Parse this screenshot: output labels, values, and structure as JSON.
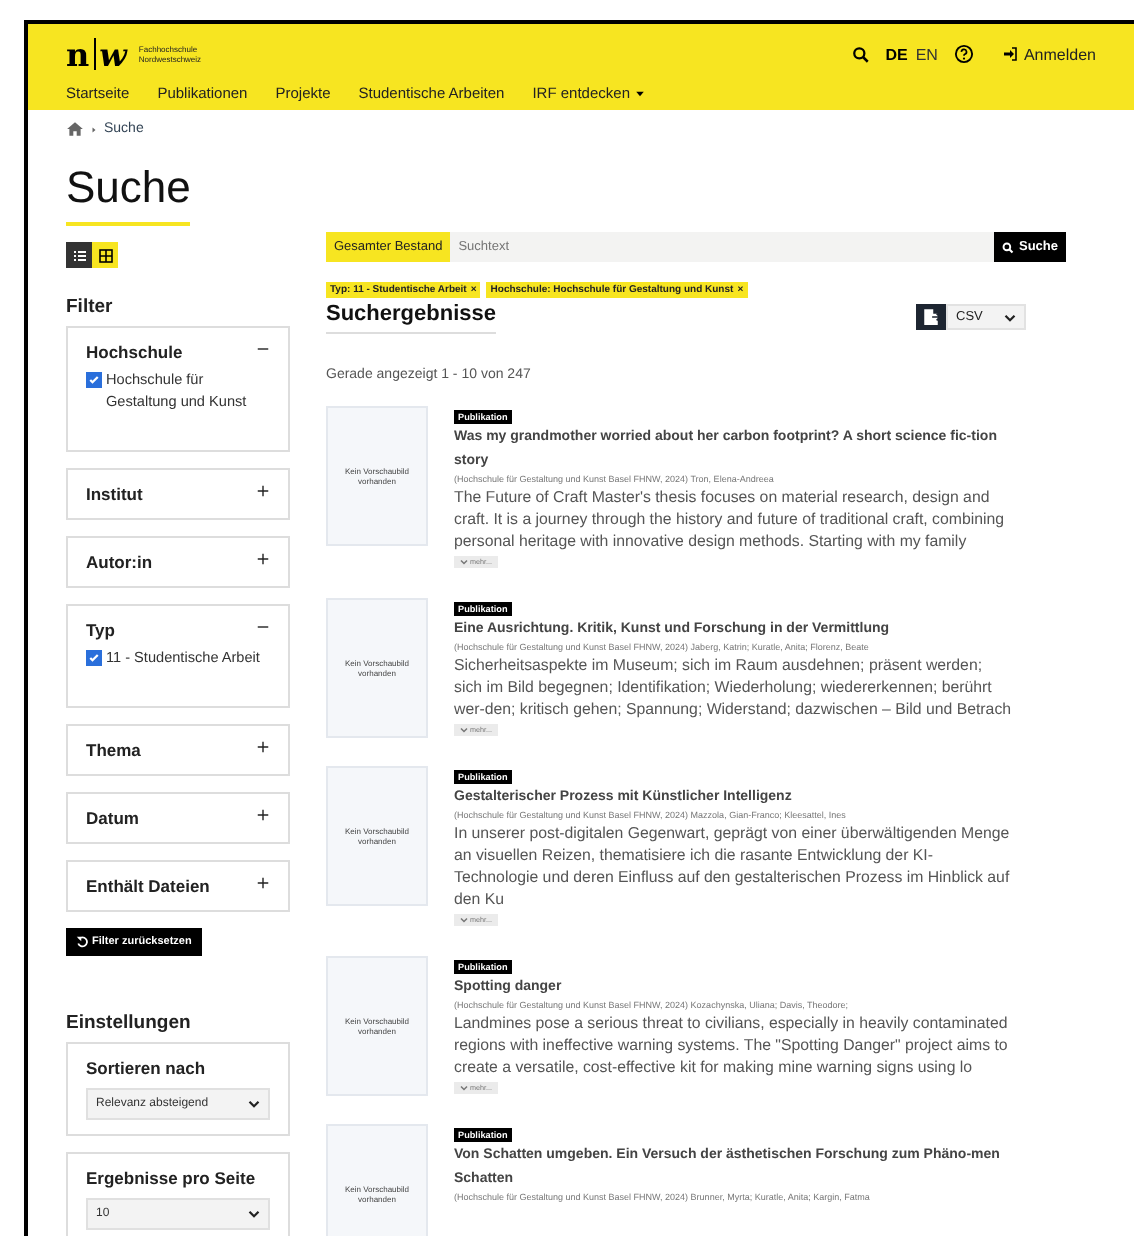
{
  "logo": {
    "mark_left": "n",
    "mark_right": "w",
    "name_lines": [
      "Fachhochschule",
      "Nordwestschweiz"
    ]
  },
  "header": {
    "languages": [
      {
        "label": "DE",
        "selected": true
      },
      {
        "label": "EN",
        "selected": false
      }
    ],
    "login": "Anmelden"
  },
  "nav": [
    {
      "label": "Startseite",
      "dropdown": false
    },
    {
      "label": "Publikationen",
      "dropdown": false
    },
    {
      "label": "Projekte",
      "dropdown": false
    },
    {
      "label": "Studentische Arbeiten",
      "dropdown": false
    },
    {
      "label": "IRF entdecken",
      "dropdown": true
    }
  ],
  "breadcrumb": [
    "Suche"
  ],
  "page_title": "Suche",
  "view_toggle": [
    {
      "kind": "list",
      "selected": true
    },
    {
      "kind": "grid",
      "selected": false
    }
  ],
  "filter": {
    "title": "Filter",
    "groups": [
      {
        "label": "Hochschule",
        "expanded": true,
        "options": [
          {
            "label": "Hochschule für Gestaltung und Kunst",
            "checked": true
          }
        ]
      },
      {
        "label": "Institut",
        "expanded": false
      },
      {
        "label": "Autor:in",
        "expanded": false
      },
      {
        "label": "Typ",
        "expanded": true,
        "options": [
          {
            "label": "11 - Studentische Arbeit",
            "checked": true
          }
        ]
      },
      {
        "label": "Thema",
        "expanded": false
      },
      {
        "label": "Datum",
        "expanded": false
      },
      {
        "label": "Enthält Dateien",
        "expanded": false
      }
    ],
    "reset": "Filter zurücksetzen"
  },
  "settings": {
    "title": "Einstellungen",
    "selects": [
      {
        "label": "Sortieren nach",
        "value": "Relevanz absteigend"
      },
      {
        "label": "Ergebnisse pro Seite",
        "value": "10"
      }
    ]
  },
  "search": {
    "scope": "Gesamter Bestand",
    "placeholder": "Suchtext",
    "button": "Suche"
  },
  "active_filters": [
    {
      "label": "Typ: 11 - Studentische Arbeit",
      "remove": "×"
    },
    {
      "label": "Hochschule: Hochschule für Gestaltung und Kunst",
      "remove": "×"
    }
  ],
  "results": {
    "title": "Suchergebnisse",
    "export_format": "CSV",
    "count": "Gerade angezeigt 1 - 10 von 247",
    "items": [
      {
        "thumbnail": "Kein Vorschaubild vorhanden",
        "badge": "Publikation",
        "title": "Was my grandmother worried about her carbon footprint? A short science fic-tion story",
        "meta": "(Hochschule für Gestaltung und Kunst Basel FHNW, 2024) Tron, Elena-Andreea",
        "description": "The Future of Craft Master's thesis focuses on material research, design and craft. It is a journey through the history and future of traditional craft, combining personal heritage with innovative design methods. Starting with my family",
        "more": "mehr..."
      },
      {
        "thumbnail": "Kein Vorschaubild vorhanden",
        "badge": "Publikation",
        "title": "Eine Ausrichtung. Kritik, Kunst und Forschung in der Vermittlung",
        "meta": "(Hochschule für Gestaltung und Kunst Basel FHNW, 2024) Jaberg, Katrin; Kuratle, Anita; Florenz, Beate",
        "description": "Sicherheitsaspekte im Museum; sich im Raum ausdehnen; präsent werden; sich im Bild begegnen; Identifikation; Wiederholung; wiedererkennen; berührt wer-den; kritisch gehen; Spannung; Widerstand; dazwischen – Bild und Betrach",
        "more": "mehr..."
      },
      {
        "thumbnail": "Kein Vorschaubild vorhanden",
        "badge": "Publikation",
        "title": "Gestalterischer Prozess mit Künstlicher Intelligenz",
        "meta": "(Hochschule für Gestaltung und Kunst Basel FHNW, 2024) Mazzola, Gian-Franco; Kleesattel, Ines",
        "description": "In unserer post-digitalen Gegenwart, geprägt von einer überwältigenden Menge an visuellen Reizen, thematisiere ich die rasante Entwicklung der KI-Technologie und deren Einfluss auf den gestalterischen Prozess im Hinblick auf den Ku",
        "more": "mehr..."
      },
      {
        "thumbnail": "Kein Vorschaubild vorhanden",
        "badge": "Publikation",
        "title": "Spotting danger",
        "meta": "(Hochschule für Gestaltung und Kunst Basel FHNW, 2024) Kozachynska, Uliana; Davis, Theodore;",
        "description": "Landmines pose a serious threat to civilians, especially in heavily contaminated regions with ineffective warning systems. The \"Spotting Danger\" project aims to create a versatile, cost-effective kit for making mine warning signs using lo",
        "more": "mehr..."
      },
      {
        "thumbnail": "Kein Vorschaubild vorhanden",
        "badge": "Publikation",
        "title": "Von Schatten umgeben. Ein Versuch der ästhetischen Forschung zum Phäno-men Schatten",
        "meta": "(Hochschule für Gestaltung und Kunst Basel FHNW, 2024) Brunner, Myrta; Kuratle, Anita; Kargin, Fatma"
      }
    ]
  }
}
